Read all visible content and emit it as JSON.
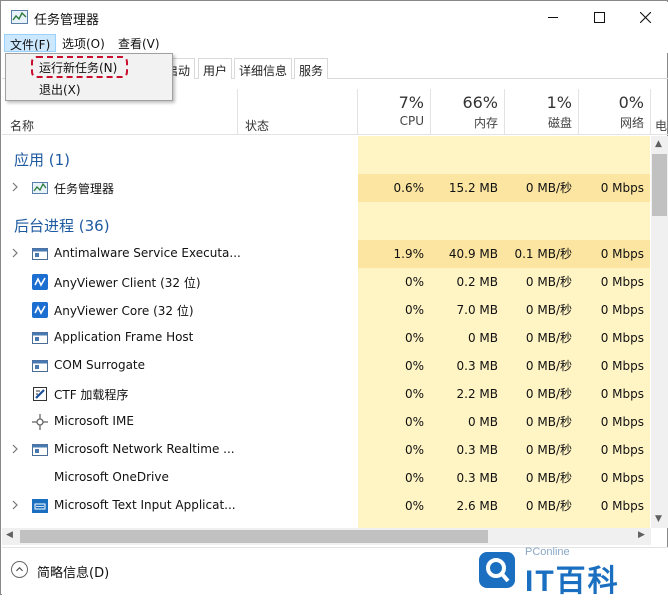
{
  "window": {
    "title": "任务管理器",
    "controls": [
      "minimize-icon",
      "maximize-icon",
      "close-icon"
    ]
  },
  "menubar": {
    "items": [
      {
        "label": "文件(F)"
      },
      {
        "label": "选项(O)"
      },
      {
        "label": "查看(V)"
      }
    ]
  },
  "file_menu": {
    "items": [
      {
        "label": "运行新任务(N)"
      },
      {
        "label": "退出(X)"
      }
    ]
  },
  "tabs": [
    {
      "label": "启动"
    },
    {
      "label": "用户"
    },
    {
      "label": "详细信息"
    },
    {
      "label": "服务"
    }
  ],
  "columns": {
    "name": "名称",
    "status": "状态",
    "cpu": {
      "pct": "7%",
      "label": "CPU"
    },
    "memory": {
      "pct": "66%",
      "label": "内存"
    },
    "disk": {
      "pct": "1%",
      "label": "磁盘"
    },
    "network": {
      "pct": "0%",
      "label": "网络"
    },
    "extra": "电"
  },
  "groups": {
    "apps": "应用 (1)",
    "background": "后台进程 (36)"
  },
  "rows": [
    {
      "name": "任务管理器",
      "icon": "task-manager-icon",
      "expandable": true,
      "cpu": "0.6%",
      "mem": "15.2 MB",
      "disk": "0 MB/秒",
      "net": "0 Mbps"
    },
    {
      "name": "Antimalware Service Executa...",
      "icon": "service-icon",
      "expandable": true,
      "cpu": "1.9%",
      "mem": "40.9 MB",
      "disk": "0.1 MB/秒",
      "net": "0 Mbps"
    },
    {
      "name": "AnyViewer Client (32 位)",
      "icon": "anyviewer-icon",
      "expandable": false,
      "cpu": "0%",
      "mem": "0.2 MB",
      "disk": "0 MB/秒",
      "net": "0 Mbps"
    },
    {
      "name": "AnyViewer Core (32 位)",
      "icon": "anyviewer-icon",
      "expandable": false,
      "cpu": "0%",
      "mem": "7.0 MB",
      "disk": "0 MB/秒",
      "net": "0 Mbps"
    },
    {
      "name": "Application Frame Host",
      "icon": "service-icon",
      "expandable": false,
      "cpu": "0%",
      "mem": "0 MB",
      "disk": "0 MB/秒",
      "net": "0 Mbps"
    },
    {
      "name": "COM Surrogate",
      "icon": "service-icon",
      "expandable": false,
      "cpu": "0%",
      "mem": "0.3 MB",
      "disk": "0 MB/秒",
      "net": "0 Mbps"
    },
    {
      "name": "CTF 加载程序",
      "icon": "ctf-icon",
      "expandable": false,
      "cpu": "0%",
      "mem": "2.2 MB",
      "disk": "0 MB/秒",
      "net": "0 Mbps"
    },
    {
      "name": "Microsoft IME",
      "icon": "ime-icon",
      "expandable": false,
      "cpu": "0%",
      "mem": "0 MB",
      "disk": "0 MB/秒",
      "net": "0 Mbps"
    },
    {
      "name": "Microsoft Network Realtime ...",
      "icon": "service-icon",
      "expandable": true,
      "cpu": "0%",
      "mem": "0.3 MB",
      "disk": "0 MB/秒",
      "net": "0 Mbps"
    },
    {
      "name": "Microsoft OneDrive",
      "icon": "",
      "expandable": false,
      "cpu": "0%",
      "mem": "0.3 MB",
      "disk": "0 MB/秒",
      "net": "0 Mbps"
    },
    {
      "name": "Microsoft Text Input Applicat...",
      "icon": "text-input-icon",
      "expandable": true,
      "cpu": "0%",
      "mem": "2.6 MB",
      "disk": "0 MB/秒",
      "net": "0 Mbps"
    }
  ],
  "footer": {
    "label": "简略信息(D)"
  },
  "watermark": {
    "small": "PConline",
    "big": "IT百科"
  }
}
